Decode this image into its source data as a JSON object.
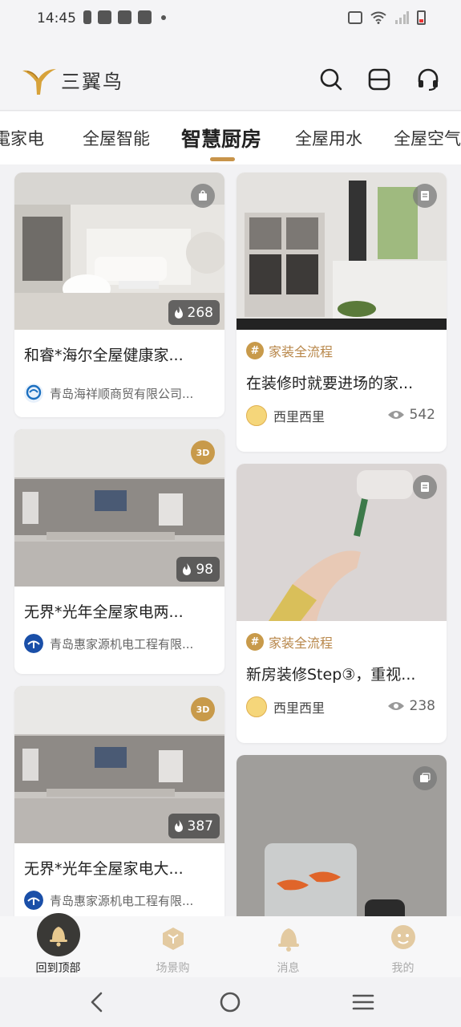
{
  "status_bar": {
    "time": "14:45"
  },
  "brand": {
    "name": "三翼鸟"
  },
  "tabs": [
    {
      "label": "家电"
    },
    {
      "label": "全屋智能"
    },
    {
      "label": "智慧厨房"
    },
    {
      "label": "全屋用水"
    },
    {
      "label": "全屋空气"
    }
  ],
  "active_tab": "智慧厨房",
  "feed": {
    "left": [
      {
        "title": "和睿*海尔全屋健康家...",
        "org": "青岛海祥顺商贸有限公司...",
        "heat": "268",
        "badge": "bag"
      },
      {
        "title": "无界*光年全屋家电两...",
        "org": "青岛惠家源机电工程有限...",
        "heat": "98",
        "badge": "3D"
      },
      {
        "title": "无界*光年全屋家电大...",
        "org": "青岛惠家源机电工程有限...",
        "heat": "387",
        "badge": "3D"
      }
    ],
    "right": [
      {
        "tag": "家装全流程",
        "title": "在装修时就要进场的家...",
        "author": "西里西里",
        "views": "542",
        "badge": "doc"
      },
      {
        "tag": "家装全流程",
        "title": "新房装修Step③，重视...",
        "author": "西里西里",
        "views": "238",
        "badge": "doc"
      },
      {
        "badge": "gallery"
      }
    ]
  },
  "bottom_nav": [
    {
      "label": "回到顶部",
      "icon": "bell-top-icon",
      "active": true
    },
    {
      "label": "场景购",
      "icon": "cube-icon"
    },
    {
      "label": "消息",
      "icon": "bell-icon"
    },
    {
      "label": "我的",
      "icon": "user-icon"
    }
  ],
  "colors": {
    "accent": "#c8944a",
    "tag": "#b8874a"
  }
}
